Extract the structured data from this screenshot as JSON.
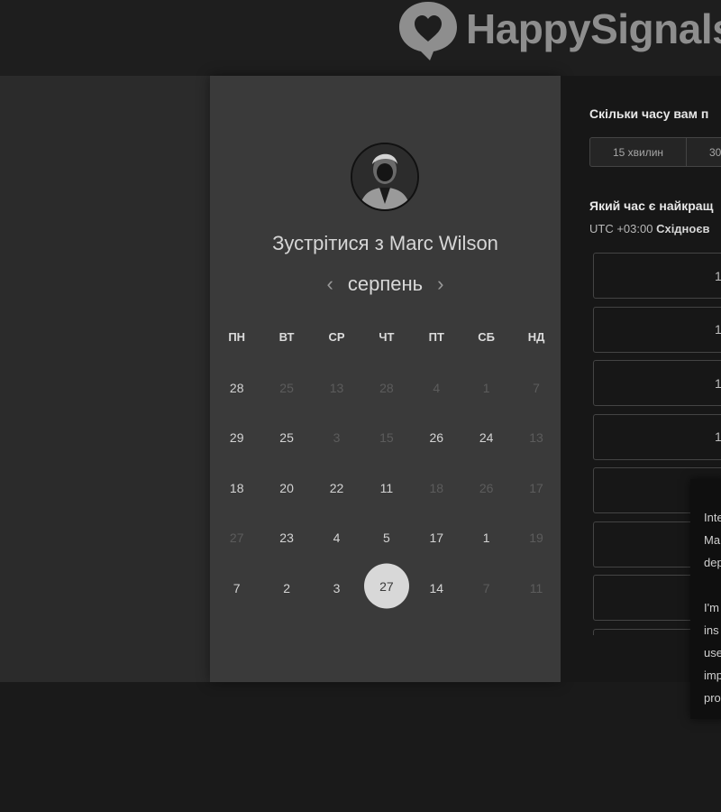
{
  "brand": {
    "name": "HappySignals",
    "color": "#8e8e8e"
  },
  "scheduler": {
    "title_prefix": "Зустрітися з",
    "host_name": "Marc Wilson",
    "month": "серпень",
    "prev_month_icon": "chevron-left-icon",
    "next_month_icon": "chevron-right-icon",
    "weekdays": [
      "ПН",
      "ВТ",
      "СР",
      "ЧТ",
      "ПТ",
      "СБ",
      "НД"
    ],
    "weeks": [
      [
        {
          "d": "28",
          "dim": false
        },
        {
          "d": "25",
          "dim": true
        },
        {
          "d": "13",
          "dim": true
        },
        {
          "d": "28",
          "dim": true
        },
        {
          "d": "4",
          "dim": true
        },
        {
          "d": "1",
          "dim": true
        },
        {
          "d": "7",
          "dim": true
        }
      ],
      [
        {
          "d": "29",
          "dim": false
        },
        {
          "d": "25",
          "dim": false
        },
        {
          "d": "3",
          "dim": true
        },
        {
          "d": "15",
          "dim": true
        },
        {
          "d": "26",
          "dim": false
        },
        {
          "d": "24",
          "dim": false
        },
        {
          "d": "13",
          "dim": true
        }
      ],
      [
        {
          "d": "18",
          "dim": false
        },
        {
          "d": "20",
          "dim": false
        },
        {
          "d": "22",
          "dim": false
        },
        {
          "d": "11",
          "dim": false
        },
        {
          "d": "18",
          "dim": true
        },
        {
          "d": "26",
          "dim": true
        },
        {
          "d": "17",
          "dim": true
        }
      ],
      [
        {
          "d": "27",
          "dim": true
        },
        {
          "d": "23",
          "dim": false
        },
        {
          "d": "4",
          "dim": false
        },
        {
          "d": "5",
          "dim": false
        },
        {
          "d": "17",
          "dim": false
        },
        {
          "d": "1",
          "dim": false
        },
        {
          "d": "19",
          "dim": true
        }
      ],
      [
        {
          "d": "7",
          "dim": false
        },
        {
          "d": "2",
          "dim": false
        },
        {
          "d": "3",
          "dim": false
        },
        {
          "d": "27",
          "dim": false,
          "selected": true
        },
        {
          "d": "14",
          "dim": false
        },
        {
          "d": "7",
          "dim": true
        },
        {
          "d": "11",
          "dim": true
        }
      ]
    ]
  },
  "booking": {
    "duration_question": "Скільки часу вам п",
    "durations": [
      "15 хвилин",
      "30"
    ],
    "time_question": "Який час є найкращ",
    "timezone_offset": "UTC +03:00",
    "timezone_name": "Східноєв",
    "slots": [
      "1",
      "1",
      "1",
      "1",
      "",
      "",
      "",
      ""
    ]
  },
  "tooltip": {
    "lines": [
      "Inte",
      "Ma",
      "dep",
      "",
      "I'm",
      "ins",
      "use",
      "imp",
      "pro"
    ]
  }
}
